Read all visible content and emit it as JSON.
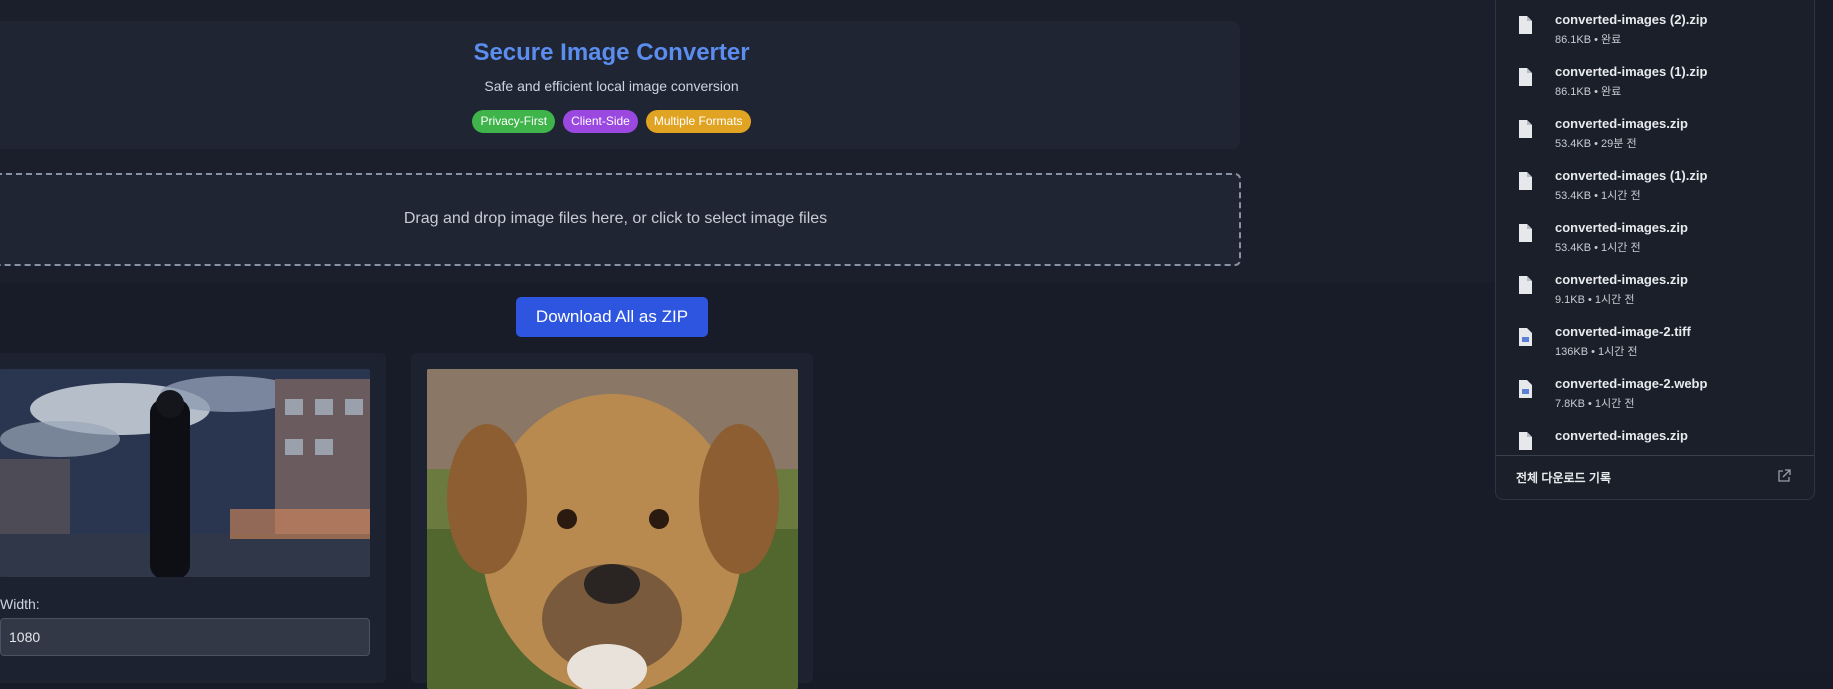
{
  "header": {
    "title": "Secure Image Converter",
    "subtitle": "Safe and efficient local image conversion",
    "badges": [
      {
        "label": "Privacy-First",
        "color": "#3fb44a"
      },
      {
        "label": "Client-Side",
        "color": "#9a48e0"
      },
      {
        "label": "Multiple Formats",
        "color": "#e0a422"
      }
    ]
  },
  "dropzone": {
    "text": "Drag and drop image files here, or click to select image files"
  },
  "actions": {
    "download_zip_label": "Download All as ZIP"
  },
  "images": [
    {
      "icon": "anime-night-street-image",
      "width_label": "Width:",
      "width_value": "1080"
    },
    {
      "icon": "dog-portrait-image"
    }
  ],
  "downloads_panel": {
    "items": [
      {
        "name": "converted-images (2).zip",
        "meta": "86.1KB • 완료",
        "icon": "file-icon"
      },
      {
        "name": "converted-images (1).zip",
        "meta": "86.1KB • 완료",
        "icon": "file-icon"
      },
      {
        "name": "converted-images.zip",
        "meta": "53.4KB • 29분 전",
        "icon": "file-icon"
      },
      {
        "name": "converted-images (1).zip",
        "meta": "53.4KB • 1시간 전",
        "icon": "file-icon"
      },
      {
        "name": "converted-images.zip",
        "meta": "53.4KB • 1시간 전",
        "icon": "file-icon"
      },
      {
        "name": "converted-images.zip",
        "meta": "9.1KB • 1시간 전",
        "icon": "file-icon"
      },
      {
        "name": "converted-image-2.tiff",
        "meta": "136KB • 1시간 전",
        "icon": "image-file-icon"
      },
      {
        "name": "converted-image-2.webp",
        "meta": "7.8KB • 1시간 전",
        "icon": "image-file-icon"
      },
      {
        "name": "converted-images.zip",
        "meta": "",
        "icon": "file-icon"
      }
    ],
    "footer_label": "전체 다운로드 기록",
    "footer_icon": "open-external-icon"
  },
  "colors": {
    "title": "#5b8def",
    "accent_button": "#2d55e0",
    "background": "#171c28"
  }
}
